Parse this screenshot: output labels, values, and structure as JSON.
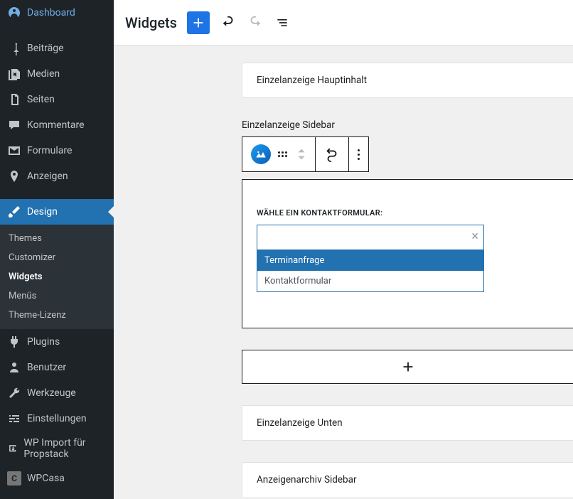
{
  "sidebar": {
    "items": [
      {
        "label": "Dashboard",
        "slug": "dashboard"
      },
      {
        "label": "Beiträge",
        "slug": "posts"
      },
      {
        "label": "Medien",
        "slug": "media"
      },
      {
        "label": "Seiten",
        "slug": "pages"
      },
      {
        "label": "Kommentare",
        "slug": "comments"
      },
      {
        "label": "Formulare",
        "slug": "forms"
      },
      {
        "label": "Anzeigen",
        "slug": "listings"
      },
      {
        "label": "Design",
        "slug": "design"
      }
    ],
    "design_submenu": [
      {
        "label": "Themes"
      },
      {
        "label": "Customizer"
      },
      {
        "label": "Widgets",
        "current": true
      },
      {
        "label": "Menüs"
      },
      {
        "label": "Theme-Lizenz"
      }
    ],
    "after_items": [
      {
        "label": "Plugins",
        "slug": "plugins"
      },
      {
        "label": "Benutzer",
        "slug": "users"
      },
      {
        "label": "Werkzeuge",
        "slug": "tools"
      },
      {
        "label": "Einstellungen",
        "slug": "settings"
      },
      {
        "label": "WP Import für Propstack",
        "slug": "wp-import"
      },
      {
        "label": "WPCasa",
        "slug": "wpcasa"
      }
    ]
  },
  "topbar": {
    "title": "Widgets"
  },
  "areas": {
    "single_main": "Einzelanzeige Hauptinhalt",
    "single_sidebar": "Einzelanzeige Sidebar",
    "single_bottom": "Einzelanzeige Unten",
    "archive_sidebar": "Anzeigenarchiv Sidebar"
  },
  "block": {
    "form_label": "Wähle ein Kontaktformular:",
    "input_value": "",
    "options": [
      {
        "label": "Terminanfrage",
        "highlight": true
      },
      {
        "label": "Kontaktformular",
        "highlight": false
      }
    ]
  }
}
